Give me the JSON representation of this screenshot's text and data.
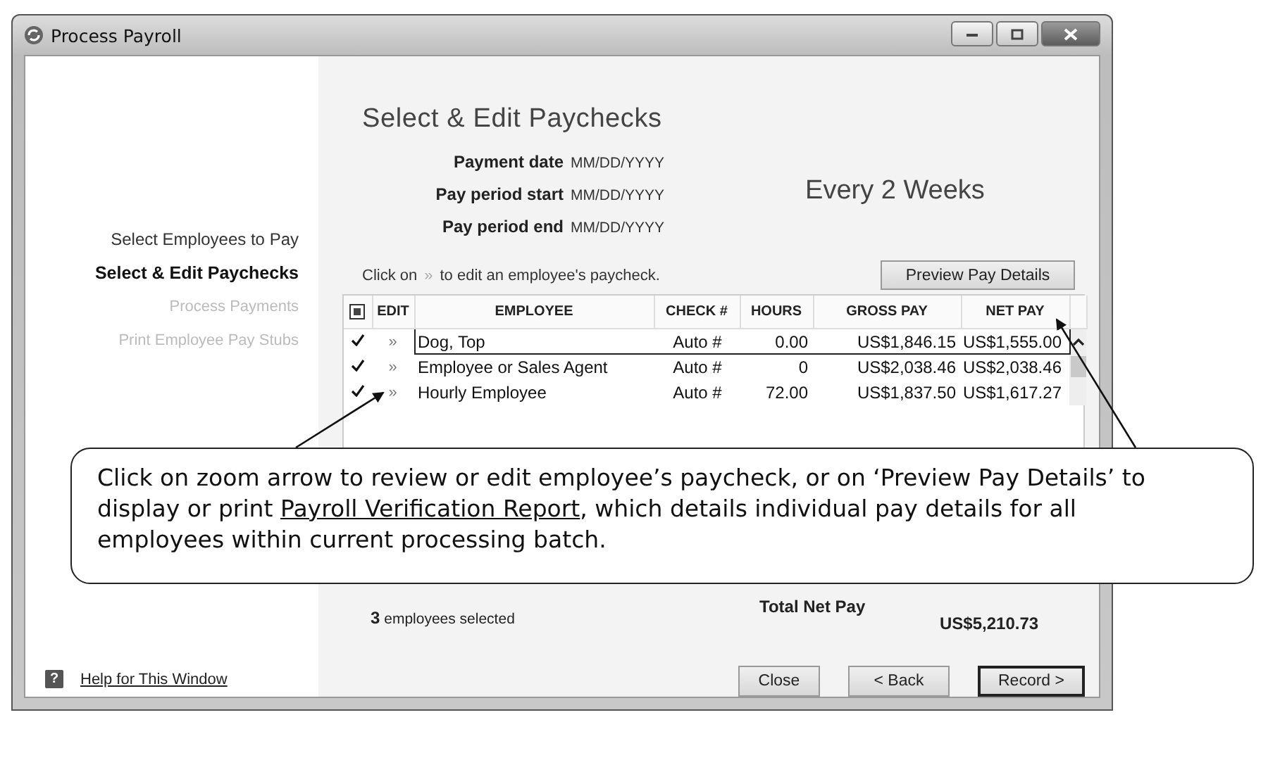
{
  "window": {
    "title": "Process Payroll"
  },
  "steps": [
    {
      "label": "Select Employees to Pay",
      "selected": false,
      "disabled": false
    },
    {
      "label": "Select & Edit Paychecks",
      "selected": true,
      "disabled": false
    },
    {
      "label": "Process Payments",
      "selected": false,
      "disabled": true
    },
    {
      "label": "Print Employee Pay Stubs",
      "selected": false,
      "disabled": true
    }
  ],
  "help_icon": "?",
  "help_link": "Help for This Window",
  "heading": "Select & Edit Paychecks",
  "fields": [
    {
      "label": "Payment date",
      "value": "MM/DD/YYYY"
    },
    {
      "label": "Pay period start",
      "value": "MM/DD/YYYY"
    },
    {
      "label": "Pay period end",
      "value": "MM/DD/YYYY"
    }
  ],
  "frequency": "Every 2 Weeks",
  "instruction": {
    "before": "Click on",
    "icon": "»",
    "after": "to edit an employee's paycheck."
  },
  "preview_button": "Preview Pay Details",
  "table": {
    "columns": [
      "EDIT",
      "EMPLOYEE",
      "CHECK #",
      "HOURS",
      "GROSS PAY",
      "NET PAY"
    ],
    "rows": [
      {
        "checked": true,
        "selected": true,
        "edit": "»",
        "employee": "Dog, Top",
        "check": "Auto #",
        "hours": "0.00",
        "gross": "US$1,846.15",
        "net": "US$1,555.00"
      },
      {
        "checked": true,
        "selected": false,
        "edit": "»",
        "employee": "Employee or Sales Agent",
        "check": "Auto #",
        "hours": "0",
        "gross": "US$2,038.46",
        "net": "US$2,038.46"
      },
      {
        "checked": true,
        "selected": false,
        "edit": "»",
        "employee": "Hourly Employee",
        "check": "Auto #",
        "hours": "72.00",
        "gross": "US$1,837.50",
        "net": "US$1,617.27"
      }
    ]
  },
  "selected_count": "**3** employees selected",
  "total": {
    "label": "Total Net Pay",
    "value": "US$5,210.73"
  },
  "buttons": [
    {
      "label": "Close",
      "default": false
    },
    {
      "label": "< Back",
      "default": false
    },
    {
      "label": "Record >",
      "default": true
    }
  ],
  "callout": {
    "before": "Click on zoom arrow to review or edit employee’s paycheck, or on ‘Preview Pay Details’ to display or print ",
    "link": "Payroll Verification Report",
    "after": ", which details individual pay details for all employees within current processing batch."
  }
}
